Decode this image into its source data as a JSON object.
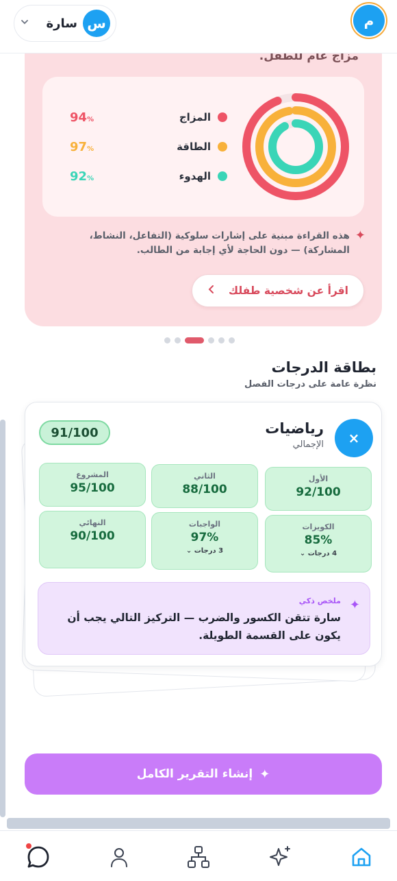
{
  "header": {
    "app_avatar_letter": "م",
    "child": {
      "initial": "س",
      "name": "سارة"
    }
  },
  "mood": {
    "heading": "مزاج عام للطفل.",
    "metrics": [
      {
        "label": "المزاج",
        "value": "94",
        "unit": "%",
        "color": "#ee5466"
      },
      {
        "label": "الطاقة",
        "value": "97",
        "unit": "%",
        "color": "#f8b13a"
      },
      {
        "label": "الهدوء",
        "value": "92",
        "unit": "%",
        "color": "#3ad5b7"
      }
    ],
    "note": "هذه القراءة مبنية على إشارات سلوكية (التفاعل، النشاط، المشاركة) — دون الحاجة لأي إجابة من الطالب.",
    "read_button": "اقرأ عن شخصية طفلك"
  },
  "pager": {
    "count": 6,
    "active": 2
  },
  "grades": {
    "title": "بطاقة الدرجات",
    "subtitle": "نظرة عامة على درجات الفصل",
    "subject": "رياضيات",
    "subject_sub": "الإجمالي",
    "subject_icon": "multiply-icon",
    "total": "91/100",
    "tiles": [
      {
        "title": "الأول",
        "value": "92/100"
      },
      {
        "title": "الثاني",
        "value": "88/100"
      },
      {
        "title": "المشروع",
        "value": "95/100"
      },
      {
        "title": "الكويزات",
        "value": "85%",
        "extra": "4 درجات"
      },
      {
        "title": "الواجبات",
        "value": "97%",
        "extra": "3 درجات"
      },
      {
        "title": "النهائي",
        "value": "90/100"
      }
    ],
    "ai_title": "ملخص ذكي",
    "ai_text": "سارة تتقن الكسور والضرب — التركيز التالي يجب أن يكون على القسمة الطويلة."
  },
  "generate_button": "إنشاء التقرير الكامل",
  "nav": {
    "items": [
      "home-icon",
      "sparkles-icon",
      "hierarchy-icon",
      "user-icon",
      "chat-icon"
    ],
    "active": "home-icon",
    "accent": "#1da1f2"
  }
}
